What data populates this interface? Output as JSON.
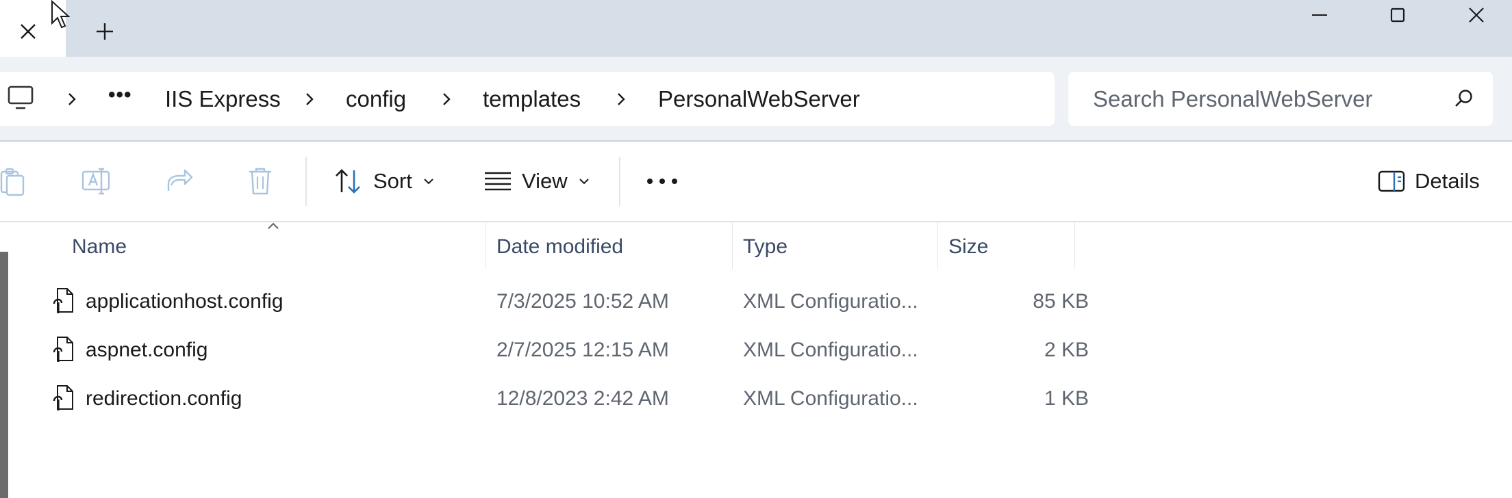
{
  "window": {
    "tab_close_icon": "close-icon",
    "new_tab_icon": "plus-icon",
    "minimize_icon": "minimize-icon",
    "maximize_icon": "maximize-icon",
    "close_icon": "close-icon"
  },
  "address_bar": {
    "root_icon": "computer-icon",
    "overflow": "•••",
    "crumbs": [
      "IIS Express",
      "config",
      "templates",
      "PersonalWebServer"
    ]
  },
  "search": {
    "placeholder": "Search PersonalWebServer",
    "value": ""
  },
  "toolbar": {
    "paste_icon": "paste-icon",
    "rename_icon": "rename-icon",
    "share_icon": "share-icon",
    "delete_icon": "delete-icon",
    "sort_label": "Sort",
    "view_label": "View",
    "more_icon": "more-icon",
    "details_label": "Details"
  },
  "columns": {
    "name": "Name",
    "date_modified": "Date modified",
    "type": "Type",
    "size": "Size"
  },
  "files": [
    {
      "name": "applicationhost.config",
      "date": "7/3/2025 10:52 AM",
      "type": "XML Configuratio...",
      "size": "85 KB"
    },
    {
      "name": "aspnet.config",
      "date": "2/7/2025 12:15 AM",
      "type": "XML Configuratio...",
      "size": "2 KB"
    },
    {
      "name": "redirection.config",
      "date": "12/8/2023 2:42 AM",
      "type": "XML Configuratio...",
      "size": "1 KB"
    }
  ],
  "colors": {
    "titlebar": "#d6dee8",
    "address_row": "#eef1f5",
    "accent": "#2f6fb3",
    "header_text": "#3a4a66"
  }
}
